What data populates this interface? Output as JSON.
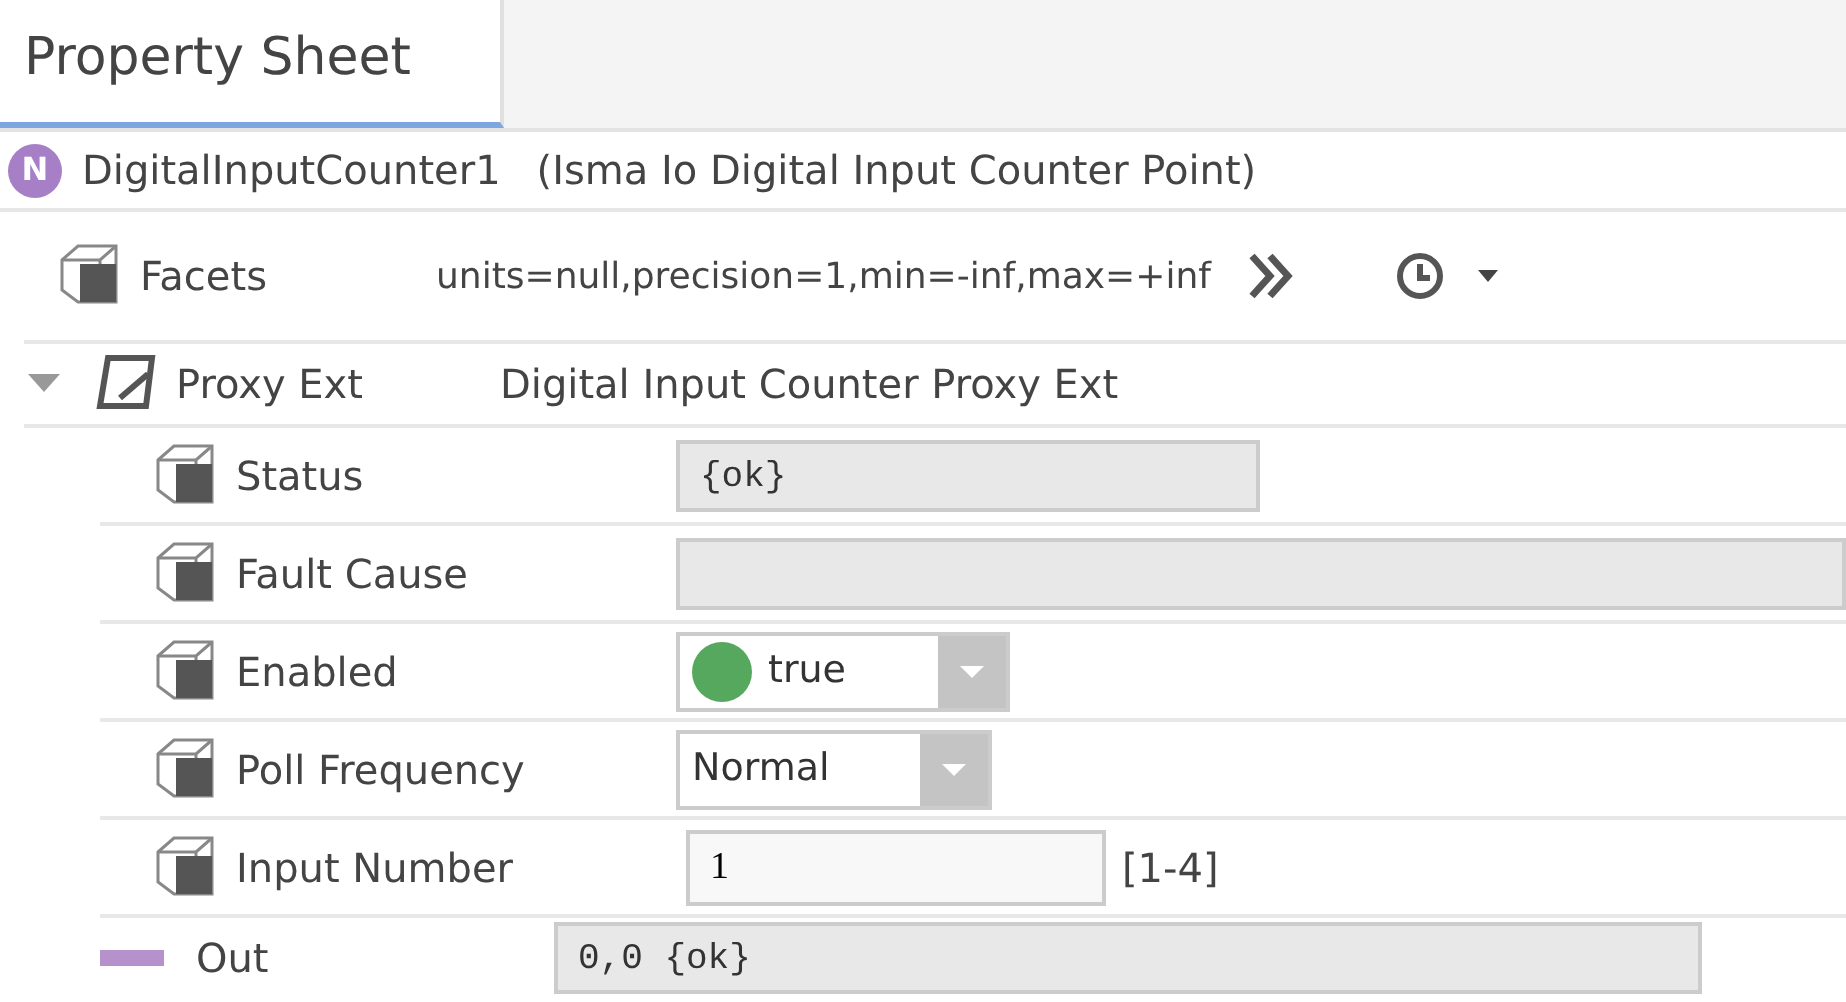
{
  "tab": {
    "label": "Property Sheet",
    "selected": true
  },
  "component": {
    "badge": "N",
    "name": "DigitalInputCounter1",
    "type": "(Isma Io Digital Input Counter Point)"
  },
  "properties": [
    {
      "kind": "facets",
      "label": "Facets",
      "value": "units=null,precision=1,min=-inf,max=+inf"
    },
    {
      "kind": "extension",
      "label": "Proxy Ext",
      "value": "Digital Input Counter Proxy Ext",
      "expanded": true,
      "children": [
        {
          "kind": "readonly",
          "label": "Status",
          "value": "{ok}"
        },
        {
          "kind": "readonly",
          "label": "Fault Cause"
        },
        {
          "kind": "dropdown",
          "label": "Enabled",
          "value": "true",
          "color": "#57a85f"
        },
        {
          "kind": "dropdown",
          "label": "Poll Frequency",
          "value": "Normal"
        },
        {
          "kind": "input",
          "label": "Input Number",
          "value": "1",
          "range": "[1-4]"
        }
      ]
    },
    {
      "kind": "output",
      "label": "Out",
      "value": "0,0 {ok}"
    }
  ]
}
